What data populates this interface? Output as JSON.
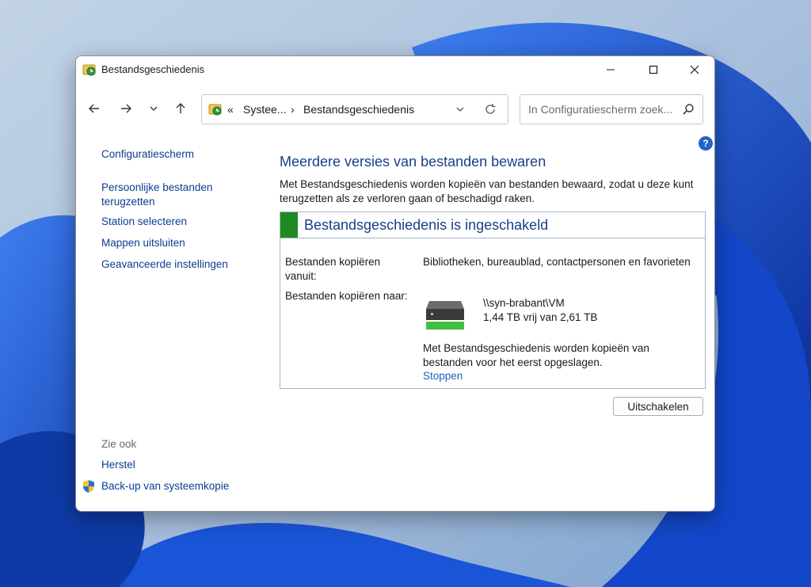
{
  "window": {
    "title": "Bestandsgeschiedenis"
  },
  "navigation": {
    "breadcrumb_overflow": "«",
    "breadcrumb_parent": "Systee...",
    "breadcrumb_separator": "›",
    "breadcrumb_current": "Bestandsgeschiedenis",
    "search_placeholder": "In Configuratiescherm zoek..."
  },
  "sidebar": {
    "home": "Configuratiescherm",
    "items": [
      "Persoonlijke bestanden terugzetten",
      "Station selecteren",
      "Mappen uitsluiten",
      "Geavanceerde instellingen"
    ],
    "see_also_label": "Zie ook",
    "see_also": [
      "Herstel",
      "Back-up van systeemkopie"
    ]
  },
  "main": {
    "heading": "Meerdere versies van bestanden bewaren",
    "intro": "Met Bestandsgeschiedenis worden kopieën van bestanden bewaard, zodat u deze kunt terugzetten als ze verloren gaan of beschadigd raken.",
    "status_title": "Bestandsgeschiedenis is ingeschakeld",
    "copy_from_label": "Bestanden kopiëren vanuit:",
    "copy_from_value": "Bibliotheken, bureaublad, contactpersonen en favorieten",
    "copy_to_label": "Bestanden kopiëren naar:",
    "drive_path": "\\\\syn-brabant\\VM",
    "drive_space": "1,44 TB vrij van 2,61 TB",
    "status_note": "Met Bestandsgeschiedenis worden kopieën van bestanden voor het eerst opgeslagen.",
    "stop_link": "Stoppen",
    "disable_button": "Uitschakelen",
    "help_glyph": "?"
  },
  "colors": {
    "status_ok": "#1f8a1f",
    "heading": "#1a3f8a",
    "link": "#0b3d91",
    "accent": "#1f63c6"
  }
}
